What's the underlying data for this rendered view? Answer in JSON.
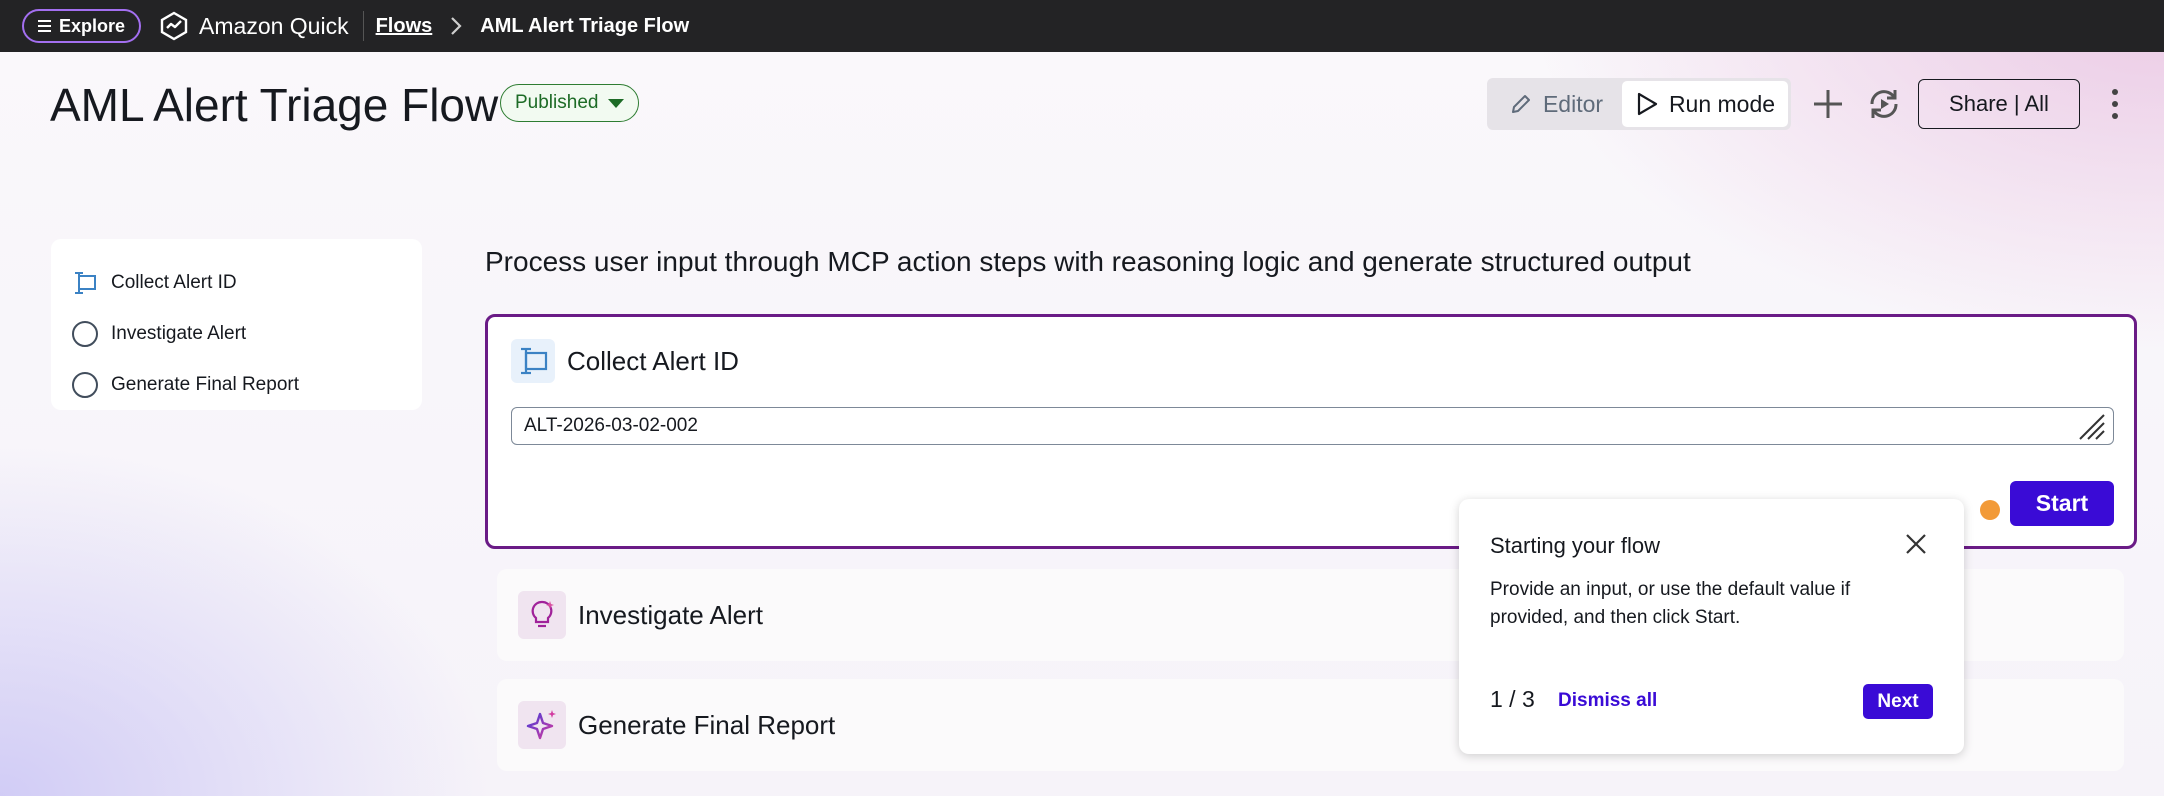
{
  "topbar": {
    "explore_label": "Explore",
    "brand_name": "Amazon Quick",
    "breadcrumb_flows": "Flows",
    "breadcrumb_current": "AML Alert Triage Flow"
  },
  "header": {
    "title": "AML Alert Triage Flow",
    "status": "Published",
    "editor_label": "Editor",
    "run_mode_label": "Run mode",
    "share_label": "Share | All"
  },
  "sidebar": {
    "steps": [
      {
        "label": "Collect Alert ID",
        "icon": "text-input-icon"
      },
      {
        "label": "Investigate Alert",
        "icon": "circle-icon"
      },
      {
        "label": "Generate Final Report",
        "icon": "circle-icon"
      }
    ]
  },
  "main": {
    "description": "Process user input through MCP action steps with reasoning logic and generate structured output",
    "active_step": {
      "title": "Collect Alert ID",
      "input_value": "ALT-2026-03-02-002",
      "start_label": "Start"
    },
    "steps": [
      {
        "title": "Investigate Alert",
        "icon": "lightbulb-icon"
      },
      {
        "title": "Generate Final Report",
        "icon": "sparkle-icon"
      }
    ]
  },
  "tour": {
    "title": "Starting your flow",
    "body": "Provide an input, or use the default value if provided, and then click Start.",
    "step_counter": "1 / 3",
    "dismiss_label": "Dismiss all",
    "next_label": "Next"
  },
  "colors": {
    "topbar": "#232325",
    "accent": "#3a0bd6",
    "active_border": "#6a1b86",
    "published": "#1d6b26",
    "hotspot": "#f29a38"
  }
}
